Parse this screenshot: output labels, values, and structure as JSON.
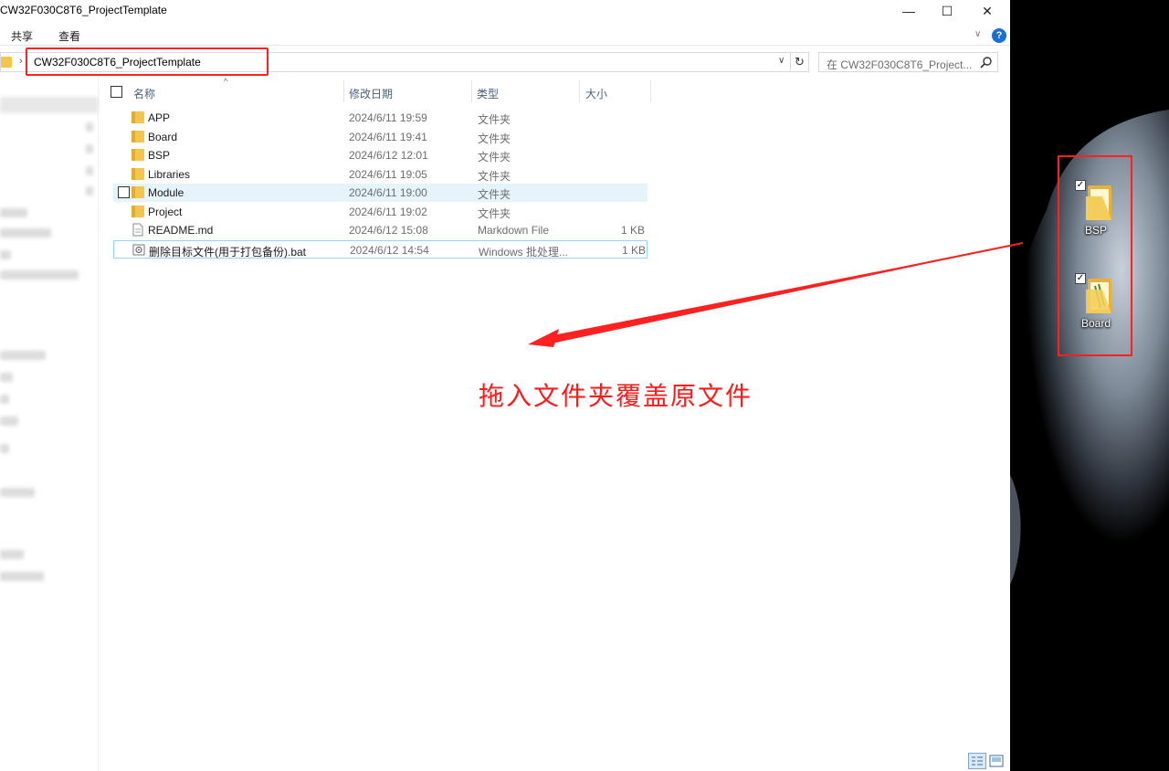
{
  "window": {
    "title": "CW32F030C8T6_ProjectTemplate",
    "minimize": "—",
    "maximize": "☐",
    "close": "✕"
  },
  "ribbon": {
    "tabs": [
      "共享",
      "查看"
    ],
    "expand": "∨",
    "help": "?"
  },
  "address": {
    "separator": "›",
    "path": "CW32F030C8T6_ProjectTemplate",
    "dropdown": "∨",
    "refresh": "↻"
  },
  "search": {
    "placeholder": "在 CW32F030C8T6_Project..."
  },
  "columns": {
    "name": "名称",
    "date": "修改日期",
    "type": "类型",
    "size": "大小",
    "sort_indicator": "^"
  },
  "files": [
    {
      "name": "APP",
      "date": "2024/6/11 19:59",
      "type": "文件夹",
      "size": "",
      "icon": "folder-icon"
    },
    {
      "name": "Board",
      "date": "2024/6/11 19:41",
      "type": "文件夹",
      "size": "",
      "icon": "folder-icon"
    },
    {
      "name": "BSP",
      "date": "2024/6/12 12:01",
      "type": "文件夹",
      "size": "",
      "icon": "folder-icon"
    },
    {
      "name": "Libraries",
      "date": "2024/6/11 19:05",
      "type": "文件夹",
      "size": "",
      "icon": "folder-icon"
    },
    {
      "name": "Module",
      "date": "2024/6/11 19:00",
      "type": "文件夹",
      "size": "",
      "icon": "folder-icon"
    },
    {
      "name": "Project",
      "date": "2024/6/11 19:02",
      "type": "文件夹",
      "size": "",
      "icon": "folder-icon"
    },
    {
      "name": "README.md",
      "date": "2024/6/12 15:08",
      "type": "Markdown File",
      "size": "1 KB",
      "icon": "document-icon"
    },
    {
      "name": "删除目标文件(用于打包备份).bat",
      "date": "2024/6/12 14:54",
      "type": "Windows 批处理...",
      "size": "1 KB",
      "icon": "batch-file-icon"
    }
  ],
  "annotation": {
    "text": "拖入文件夹覆盖原文件",
    "color": "#ff1a1a"
  },
  "desktop": {
    "items": [
      {
        "label": "BSP",
        "checked": "✓"
      },
      {
        "label": "Board",
        "checked": "✓"
      }
    ]
  },
  "colors": {
    "folder": "#f3c54d",
    "highlight": "#ff2020",
    "hover_row": "#e5f3fb"
  }
}
